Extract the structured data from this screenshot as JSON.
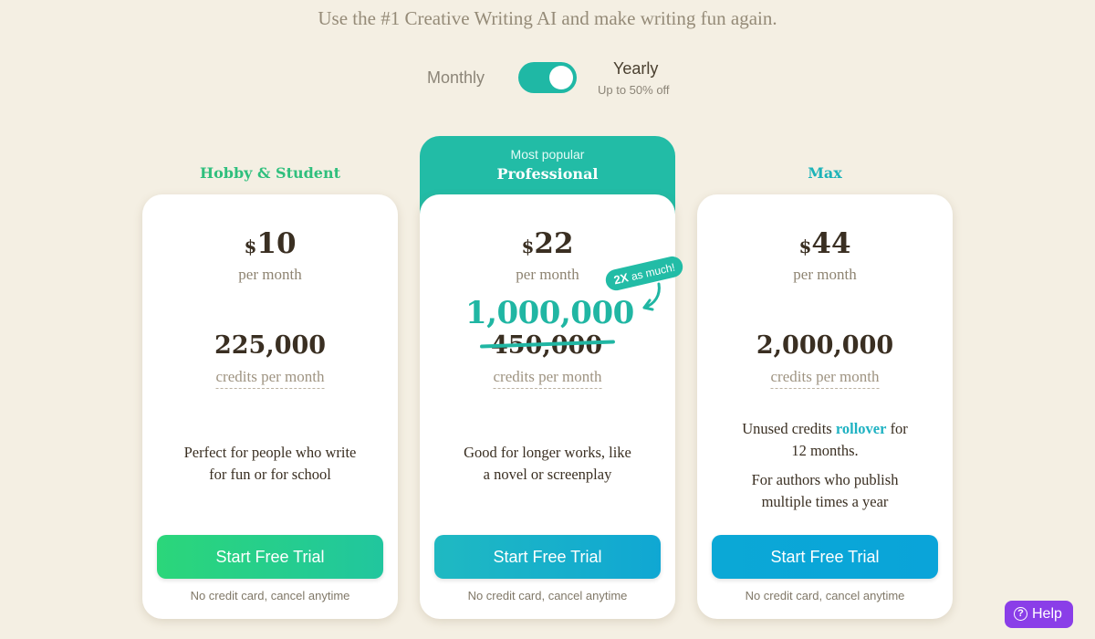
{
  "tagline": "Use the #1 Creative Writing AI and make writing fun again.",
  "billing": {
    "monthly": "Monthly",
    "yearly": "Yearly",
    "discount": "Up to 50% off"
  },
  "popular_label": "Most popular",
  "plans": [
    {
      "name": "Hobby & Student",
      "currency": "$",
      "price": "10",
      "period": "per month",
      "credits": "225,000",
      "credits_label": "credits per month",
      "desc1": "Perfect for people who write",
      "desc2": "for fun or for school",
      "cta": "Start Free Trial",
      "note": "No credit card, cancel anytime"
    },
    {
      "name": "Professional",
      "currency": "$",
      "price": "22",
      "period": "per month",
      "credits": "1,000,000",
      "old_credits": "450,000",
      "credits_label": "credits per month",
      "badge_strong": "2X",
      "badge_rest": "as much!",
      "desc1": "Good for longer works, like",
      "desc2": "a novel or screenplay",
      "cta": "Start Free Trial",
      "note": "No credit card, cancel anytime"
    },
    {
      "name": "Max",
      "currency": "$",
      "price": "44",
      "period": "per month",
      "credits": "2,000,000",
      "credits_label": "credits per month",
      "rollover_pre": "Unused credits ",
      "rollover_word": "rollover",
      "rollover_post": " for",
      "rollover_line2": "12 months.",
      "desc1": "For authors who publish",
      "desc2": "multiple times a year",
      "cta": "Start Free Trial",
      "note": "No credit card, cancel anytime"
    }
  ],
  "help": {
    "icon": "question-circle-icon",
    "label": "Help"
  },
  "colors": {
    "accent": "#22bca6",
    "help": "#8a3ee8"
  }
}
